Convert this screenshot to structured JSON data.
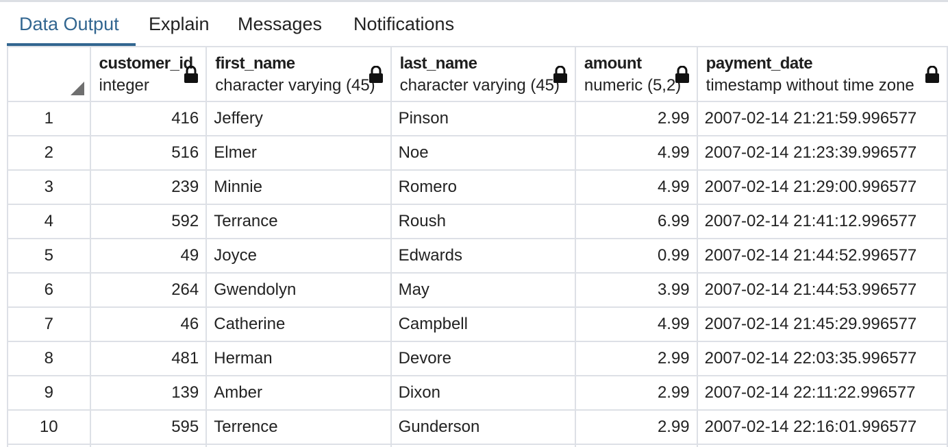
{
  "tabs": [
    {
      "label": "Data Output",
      "active": true
    },
    {
      "label": "Explain",
      "active": false
    },
    {
      "label": "Messages",
      "active": false
    },
    {
      "label": "Notifications",
      "active": false
    }
  ],
  "columns": [
    {
      "name": "customer_id",
      "type": "integer",
      "locked": true,
      "icon": "lock-icon"
    },
    {
      "name": "first_name",
      "type": "character varying (45)",
      "locked": true,
      "icon": "lock-icon"
    },
    {
      "name": "last_name",
      "type": "character varying (45)",
      "locked": true,
      "icon": "lock-icon"
    },
    {
      "name": "amount",
      "type": "numeric (5,2)",
      "locked": true,
      "icon": "lock-icon"
    },
    {
      "name": "payment_date",
      "type": "timestamp without time zone",
      "locked": true,
      "icon": "lock-icon"
    }
  ],
  "rows": [
    {
      "num": "1",
      "customer_id": "416",
      "first_name": "Jeffery",
      "last_name": "Pinson",
      "amount": "2.99",
      "payment_date": "2007-02-14 21:21:59.996577"
    },
    {
      "num": "2",
      "customer_id": "516",
      "first_name": "Elmer",
      "last_name": "Noe",
      "amount": "4.99",
      "payment_date": "2007-02-14 21:23:39.996577"
    },
    {
      "num": "3",
      "customer_id": "239",
      "first_name": "Minnie",
      "last_name": "Romero",
      "amount": "4.99",
      "payment_date": "2007-02-14 21:29:00.996577"
    },
    {
      "num": "4",
      "customer_id": "592",
      "first_name": "Terrance",
      "last_name": "Roush",
      "amount": "6.99",
      "payment_date": "2007-02-14 21:41:12.996577"
    },
    {
      "num": "5",
      "customer_id": "49",
      "first_name": "Joyce",
      "last_name": "Edwards",
      "amount": "0.99",
      "payment_date": "2007-02-14 21:44:52.996577"
    },
    {
      "num": "6",
      "customer_id": "264",
      "first_name": "Gwendolyn",
      "last_name": "May",
      "amount": "3.99",
      "payment_date": "2007-02-14 21:44:53.996577"
    },
    {
      "num": "7",
      "customer_id": "46",
      "first_name": "Catherine",
      "last_name": "Campbell",
      "amount": "4.99",
      "payment_date": "2007-02-14 21:45:29.996577"
    },
    {
      "num": "8",
      "customer_id": "481",
      "first_name": "Herman",
      "last_name": "Devore",
      "amount": "2.99",
      "payment_date": "2007-02-14 22:03:35.996577"
    },
    {
      "num": "9",
      "customer_id": "139",
      "first_name": "Amber",
      "last_name": "Dixon",
      "amount": "2.99",
      "payment_date": "2007-02-14 22:11:22.996577"
    },
    {
      "num": "10",
      "customer_id": "595",
      "first_name": "Terrence",
      "last_name": "Gunderson",
      "amount": "2.99",
      "payment_date": "2007-02-14 22:16:01.996577"
    }
  ],
  "colors": {
    "accent": "#326690",
    "grid_border": "#dde0e6",
    "text": "#222222"
  }
}
